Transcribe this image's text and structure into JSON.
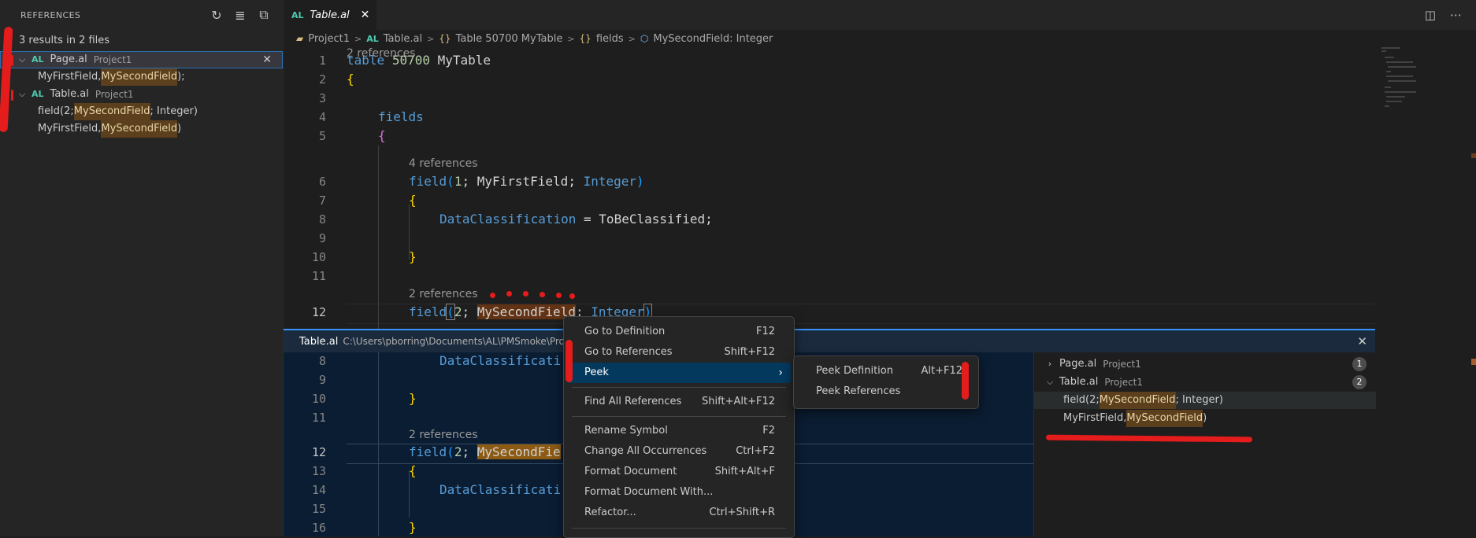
{
  "sidebar": {
    "title": "REFERENCES",
    "actions": [
      {
        "icon": "refresh-icon",
        "glyph": "↻"
      },
      {
        "icon": "clear-all-icon",
        "glyph": "≣"
      },
      {
        "icon": "collapse-all-icon",
        "glyph": "⧉"
      }
    ],
    "summary": "3 results in 2 files",
    "files": [
      {
        "name": "Page.al",
        "project": "Project1",
        "refs": [
          {
            "pre": "MyFirstField, ",
            "hl": "MySecondField",
            "post": ");"
          }
        ]
      },
      {
        "name": "Table.al",
        "project": "Project1",
        "refs": [
          {
            "pre": "field(2; ",
            "hl": "MySecondField",
            "post": "; Integer)"
          },
          {
            "pre": "MyFirstField, ",
            "hl": "MySecondField",
            "post": ")"
          }
        ]
      }
    ],
    "al_badge": "AL",
    "close_glyph": "✕"
  },
  "tab": {
    "badge": "AL",
    "title": "Table.al",
    "close": "✕",
    "split_icon": "split-editor-icon",
    "more_icon": "more-actions-icon"
  },
  "breadcrumb": {
    "project": "Project1",
    "badge": "AL",
    "file": "Table.al",
    "table": "Table 50700 MyTable",
    "fields": "fields",
    "field": "MySecondField: Integer"
  },
  "editor": {
    "lens_top": "2 references",
    "lens_field1": "4 references",
    "lens_field2": "2 references",
    "ln": [
      "1",
      "2",
      "3",
      "4",
      "5",
      "6",
      "7",
      "8",
      "9",
      "10",
      "11",
      "12"
    ],
    "table_kw": "table",
    "table_id": "50700",
    "table_name": "MyTable",
    "fields_kw": "fields",
    "field_kw": "field",
    "f1_no": "1",
    "f1_name": "MyFirstField",
    "type_int": "Integer",
    "prop": "DataClassification",
    "prop_val": "ToBeClassified",
    "f2_no": "2",
    "f2_name": "MySecondField"
  },
  "peek": {
    "file": "Table.al",
    "path": "C:\\Users\\pborring\\Documents\\AL\\PMSmoke\\Project1 -",
    "close": "✕",
    "ln": [
      "8",
      "9",
      "10",
      "11",
      "12",
      "13",
      "14",
      "15",
      "16"
    ],
    "lens": "2 references",
    "prop_part": "DataClassificati",
    "field_kw": "field",
    "f2_no": "2",
    "f2_name_part": "MySecondFie",
    "list": [
      {
        "name": "Page.al",
        "project": "Project1",
        "count": "1"
      },
      {
        "name": "Table.al",
        "project": "Project1",
        "count": "2"
      }
    ],
    "refs": [
      {
        "pre": "field(2; ",
        "hl": "MySecondField",
        "post": "; Integer)"
      },
      {
        "pre": "MyFirstField, ",
        "hl": "MySecondField",
        "post": ")"
      }
    ]
  },
  "context_menu": {
    "items": [
      {
        "label": "Go to Definition",
        "key": "F12"
      },
      {
        "label": "Go to References",
        "key": "Shift+F12"
      },
      {
        "label": "Peek",
        "key": ""
      },
      {
        "label": "Find All References",
        "key": "Shift+Alt+F12"
      },
      {
        "label": "Rename Symbol",
        "key": "F2"
      },
      {
        "label": "Change All Occurrences",
        "key": "Ctrl+F2"
      },
      {
        "label": "Format Document",
        "key": "Shift+Alt+F"
      },
      {
        "label": "Format Document With...",
        "key": ""
      },
      {
        "label": "Refactor...",
        "key": "Ctrl+Shift+R"
      }
    ],
    "submenu_arrow": "›"
  },
  "submenu": {
    "items": [
      {
        "label": "Peek Definition",
        "key": "Alt+F12"
      },
      {
        "label": "Peek References",
        "key": ""
      }
    ]
  },
  "colors": {
    "accent": "#3794ff",
    "highlight": "#613214",
    "annotation_red": "#e51c1c"
  }
}
